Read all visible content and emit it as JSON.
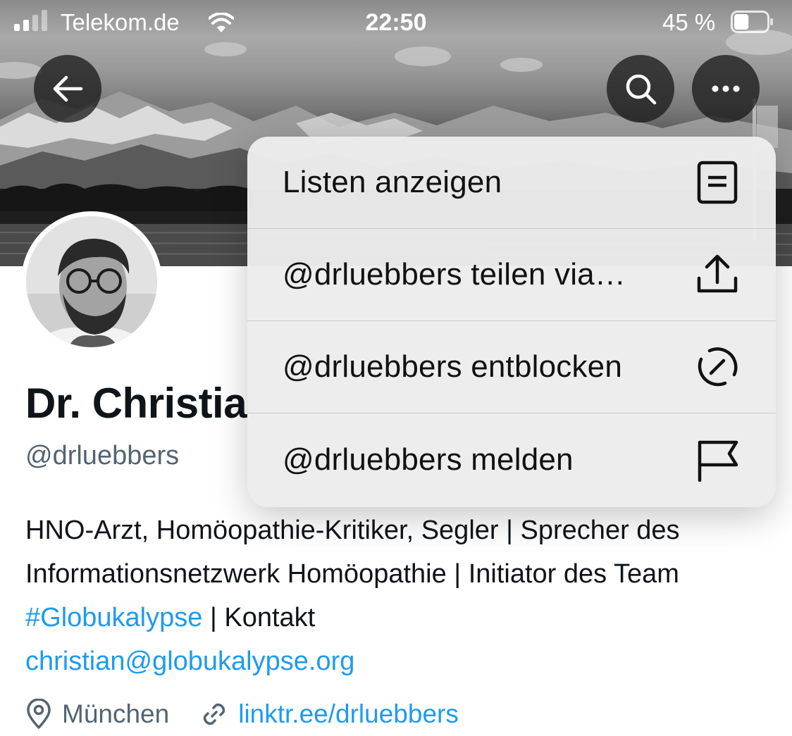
{
  "status_bar": {
    "carrier": "Telekom.de",
    "time": "22:50",
    "battery_percent": "45 %",
    "battery_level": 0.45,
    "icons": [
      "cellular-signal-icon",
      "wifi-icon",
      "battery-icon"
    ]
  },
  "header": {
    "icons": [
      "back-arrow-icon",
      "search-icon",
      "more-horizontal-icon"
    ]
  },
  "profile": {
    "name": "Dr. Christia",
    "handle": "@drluebbers",
    "bio_text_1": "HNO-Arzt, Homöopathie-Kritiker, Segler | Sprecher des Informationsnetzwerk Homöopathie | Initiator des Team ",
    "bio_hashtag": "#Globukalypse",
    "bio_text_2": " | Kontakt ",
    "bio_email": "christian@globukalypse.org",
    "location": "München",
    "website": "linktr.ee/drluebbers"
  },
  "menu": {
    "items": [
      {
        "label": "Listen anzeigen",
        "icon": "list-icon"
      },
      {
        "label": "@drluebbers teilen via…",
        "icon": "share-icon"
      },
      {
        "label": "@drluebbers entblocken",
        "icon": "unblock-icon"
      },
      {
        "label": "@drluebbers melden",
        "icon": "flag-icon"
      }
    ]
  },
  "colors": {
    "link": "#1d9bf0",
    "secondary_text": "#536471",
    "primary_text": "#0f1419"
  }
}
